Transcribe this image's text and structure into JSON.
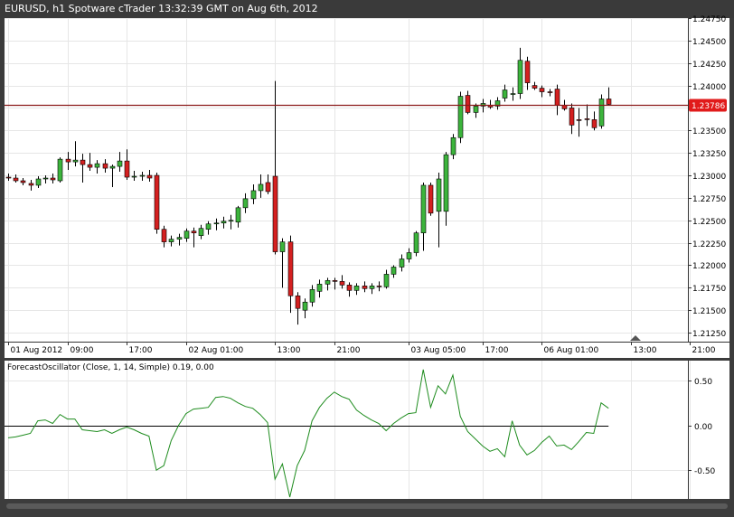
{
  "window": {
    "title": "EURUSD, h1 Spotware cTrader 13:32:39 GMT on Aug 6th, 2012"
  },
  "colors": {
    "bull": "#3cb43c",
    "bear": "#d42020",
    "price_line": "#8b1a1a",
    "price_tag": "#e11b1b",
    "oscillator": "#1e8c1e",
    "grid": "#e6e6e6",
    "frame": "#3c3c3c"
  },
  "price_panel": {
    "current_price": 1.23786,
    "current_price_label": "1.23786",
    "ylim": [
      1.2115,
      1.2475
    ],
    "y_ticks": [
      "1.24750",
      "1.24500",
      "1.24250",
      "1.24000",
      "1.23750",
      "1.23500",
      "1.23250",
      "1.23000",
      "1.22750",
      "1.22500",
      "1.22250",
      "1.22000",
      "1.21750",
      "1.21500",
      "1.21250"
    ],
    "x_ticks": [
      "01 Aug 2012",
      "09:00",
      "17:00",
      "02 Aug 01:00",
      "13:00",
      "21:00",
      "03 Aug 05:00",
      "17:00",
      "06 Aug 01:00",
      "13:00",
      "21:00"
    ]
  },
  "oscillator_panel": {
    "label": "ForecastOscillator (Close, 1, 14, Simple) 0.19, 0.00",
    "ylim": [
      -0.82,
      0.72
    ],
    "y_ticks": [
      "0.50",
      "0.00",
      "-0.50"
    ]
  },
  "chart_data": [
    {
      "type": "candlestick",
      "title": "EURUSD, h1",
      "x_labels": [
        "01 Aug 2012",
        "09:00",
        "17:00",
        "02 Aug 01:00",
        "13:00",
        "21:00",
        "03 Aug 05:00",
        "17:00",
        "06 Aug 01:00",
        "13:00",
        "21:00"
      ],
      "ohlc": [
        [
          1.2298,
          1.2302,
          1.2294,
          1.2297
        ],
        [
          1.2297,
          1.2301,
          1.2292,
          1.2294
        ],
        [
          1.2294,
          1.2297,
          1.2289,
          1.2292
        ],
        [
          1.2291,
          1.2295,
          1.2283,
          1.2289
        ],
        [
          1.2289,
          1.2299,
          1.2286,
          1.2296
        ],
        [
          1.2296,
          1.23,
          1.2291,
          1.2297
        ],
        [
          1.2297,
          1.2302,
          1.2291,
          1.2295
        ],
        [
          1.2294,
          1.232,
          1.2292,
          1.2318
        ],
        [
          1.2318,
          1.2326,
          1.2306,
          1.2315
        ],
        [
          1.2315,
          1.2338,
          1.231,
          1.2317
        ],
        [
          1.2317,
          1.2324,
          1.2292,
          1.2312
        ],
        [
          1.2312,
          1.2325,
          1.2305,
          1.2309
        ],
        [
          1.2309,
          1.2317,
          1.2302,
          1.2313
        ],
        [
          1.2313,
          1.2318,
          1.2303,
          1.2308
        ],
        [
          1.2308,
          1.2312,
          1.2287,
          1.231
        ],
        [
          1.231,
          1.2326,
          1.2304,
          1.2316
        ],
        [
          1.2316,
          1.2329,
          1.2295,
          1.2298
        ],
        [
          1.2298,
          1.2305,
          1.2294,
          1.2299
        ],
        [
          1.2299,
          1.2304,
          1.2294,
          1.23
        ],
        [
          1.23,
          1.2306,
          1.2293,
          1.2297
        ],
        [
          1.23,
          1.2303,
          1.2235,
          1.224
        ],
        [
          1.224,
          1.2244,
          1.222,
          1.2226
        ],
        [
          1.2226,
          1.2233,
          1.2221,
          1.2229
        ],
        [
          1.2229,
          1.2235,
          1.2222,
          1.2231
        ],
        [
          1.223,
          1.2241,
          1.2226,
          1.2238
        ],
        [
          1.2238,
          1.2242,
          1.222,
          1.2236
        ],
        [
          1.2233,
          1.2245,
          1.2229,
          1.2241
        ],
        [
          1.224,
          1.2249,
          1.2234,
          1.2246
        ],
        [
          1.2246,
          1.2252,
          1.2239,
          1.2247
        ],
        [
          1.2247,
          1.2254,
          1.2241,
          1.2249
        ],
        [
          1.2249,
          1.2256,
          1.224,
          1.225
        ],
        [
          1.2248,
          1.2266,
          1.2242,
          1.2264
        ],
        [
          1.2264,
          1.228,
          1.2258,
          1.2274
        ],
        [
          1.2274,
          1.229,
          1.2268,
          1.2283
        ],
        [
          1.2283,
          1.2301,
          1.2275,
          1.229
        ],
        [
          1.2292,
          1.2301,
          1.2279,
          1.2282
        ],
        [
          1.2299,
          1.2405,
          1.2212,
          1.2215
        ],
        [
          1.2215,
          1.223,
          1.2175,
          1.2226
        ],
        [
          1.2226,
          1.2233,
          1.2147,
          1.2166
        ],
        [
          1.2166,
          1.217,
          1.2134,
          1.2152
        ],
        [
          1.215,
          1.2163,
          1.2141,
          1.2159
        ],
        [
          1.2159,
          1.2178,
          1.2154,
          1.2173
        ],
        [
          1.2171,
          1.2184,
          1.2164,
          1.2179
        ],
        [
          1.2179,
          1.2186,
          1.2172,
          1.2183
        ],
        [
          1.2183,
          1.2186,
          1.2173,
          1.2182
        ],
        [
          1.2182,
          1.2189,
          1.2174,
          1.2178
        ],
        [
          1.2178,
          1.2181,
          1.2165,
          1.2172
        ],
        [
          1.2172,
          1.218,
          1.2167,
          1.2177
        ],
        [
          1.2177,
          1.2182,
          1.217,
          1.2174
        ],
        [
          1.2174,
          1.218,
          1.2168,
          1.2177
        ],
        [
          1.2177,
          1.2182,
          1.2171,
          1.2176
        ],
        [
          1.2176,
          1.2195,
          1.2174,
          1.219
        ],
        [
          1.219,
          1.22,
          1.2186,
          1.2198
        ],
        [
          1.2198,
          1.2212,
          1.2193,
          1.2207
        ],
        [
          1.2207,
          1.2219,
          1.2203,
          1.2214
        ],
        [
          1.2214,
          1.2238,
          1.221,
          1.2236
        ],
        [
          1.2236,
          1.2292,
          1.2216,
          1.2289
        ],
        [
          1.2289,
          1.2292,
          1.2255,
          1.2258
        ],
        [
          1.226,
          1.2303,
          1.222,
          1.2296
        ],
        [
          1.226,
          1.2326,
          1.2244,
          1.2323
        ],
        [
          1.2323,
          1.2346,
          1.2318,
          1.2342
        ],
        [
          1.2342,
          1.2393,
          1.2336,
          1.2388
        ],
        [
          1.2389,
          1.2394,
          1.2368,
          1.237
        ],
        [
          1.237,
          1.238,
          1.2364,
          1.2377
        ],
        [
          1.2377,
          1.2385,
          1.237,
          1.238
        ],
        [
          1.2378,
          1.2384,
          1.2374,
          1.2376
        ],
        [
          1.2377,
          1.2387,
          1.2373,
          1.2383
        ],
        [
          1.2386,
          1.2401,
          1.2382,
          1.2395
        ],
        [
          1.239,
          1.2398,
          1.2383,
          1.2391
        ],
        [
          1.2391,
          1.2442,
          1.2385,
          1.2428
        ],
        [
          1.2427,
          1.2432,
          1.2395,
          1.2403
        ],
        [
          1.24,
          1.2404,
          1.2395,
          1.2397
        ],
        [
          1.2397,
          1.24,
          1.2387,
          1.2393
        ],
        [
          1.2393,
          1.2396,
          1.2388,
          1.2392
        ],
        [
          1.2396,
          1.2401,
          1.2367,
          1.2378
        ],
        [
          1.2378,
          1.2384,
          1.2372,
          1.2374
        ],
        [
          1.2375,
          1.238,
          1.2346,
          1.2356
        ],
        [
          1.2362,
          1.2375,
          1.2343,
          1.2361
        ],
        [
          1.2363,
          1.2379,
          1.2355,
          1.2362
        ],
        [
          1.2362,
          1.2371,
          1.235,
          1.2353
        ],
        [
          1.2355,
          1.239,
          1.2352,
          1.2385
        ],
        [
          1.2385,
          1.2398,
          1.2378,
          1.2379
        ]
      ],
      "x_label_index": [
        0,
        8,
        16,
        24,
        36,
        44,
        54,
        64,
        72,
        84,
        92
      ],
      "ylim": [
        1.2115,
        1.2475
      ]
    },
    {
      "type": "line",
      "title": "ForecastOscillator (Close, 1, 14, Simple)",
      "values": [
        -0.14,
        -0.13,
        -0.11,
        -0.09,
        0.05,
        0.06,
        0.02,
        0.12,
        0.07,
        0.07,
        -0.05,
        -0.06,
        -0.07,
        -0.05,
        -0.09,
        -0.05,
        -0.02,
        -0.05,
        -0.09,
        -0.12,
        -0.5,
        -0.45,
        -0.17,
        0.0,
        0.13,
        0.18,
        0.19,
        0.2,
        0.31,
        0.32,
        0.3,
        0.25,
        0.21,
        0.19,
        0.12,
        0.03,
        -0.6,
        -0.43,
        -0.8,
        -0.45,
        -0.28,
        0.05,
        0.2,
        0.3,
        0.37,
        0.32,
        0.29,
        0.17,
        0.11,
        0.06,
        0.02,
        -0.06,
        0.02,
        0.08,
        0.13,
        0.14,
        0.62,
        0.2,
        0.44,
        0.35,
        0.56,
        0.1,
        -0.07,
        -0.15,
        -0.23,
        -0.29,
        -0.26,
        -0.35,
        0.05,
        -0.22,
        -0.33,
        -0.28,
        -0.19,
        -0.12,
        -0.23,
        -0.22,
        -0.27,
        -0.18,
        -0.08,
        -0.09,
        0.25,
        0.19
      ],
      "ylim": [
        -0.82,
        0.72
      ]
    }
  ]
}
